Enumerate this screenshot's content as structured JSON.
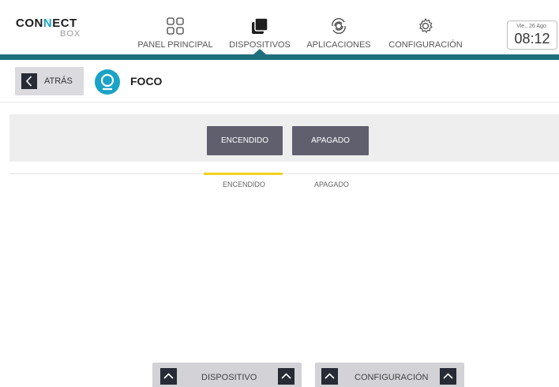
{
  "header": {
    "logo": {
      "line1_a": "CON",
      "line1_b": "N",
      "line1_c": "ECT",
      "line2": "BOX"
    },
    "nav": [
      {
        "label": "PANEL PRINCIPAL",
        "icon": "grid-icon"
      },
      {
        "label": "DISPOSITIVOS",
        "icon": "devices-icon",
        "active": true
      },
      {
        "label": "APLICACIONES",
        "icon": "apps-icon"
      },
      {
        "label": "CONFIGURACIÓN",
        "icon": "gear-icon"
      }
    ],
    "clock": {
      "date": "Vie., 26 Ago.",
      "time": "08:12"
    }
  },
  "title_row": {
    "back_label": "ATRÁS",
    "device_icon": "bulb-icon",
    "device_name": "FOCO"
  },
  "controls": {
    "on_label": "ENCENDIDO",
    "off_label": "APAGADO"
  },
  "tabs": {
    "on_label": "ENCENDIDO",
    "off_label": "APAGADO"
  },
  "drawers": {
    "device_label": "DISPOSITIVO",
    "config_label": "CONFIGURACIÓN"
  },
  "colors": {
    "accent": "#1aa3c6",
    "header_bar": "#1e6f7d",
    "button_dark": "#5f5f6e",
    "indicator": "#f1d21c"
  }
}
